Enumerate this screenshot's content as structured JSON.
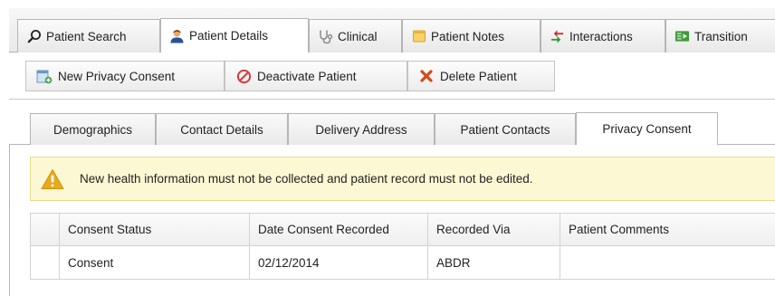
{
  "top_tabs": [
    {
      "label": "Patient Search",
      "icon": "search-icon",
      "active": false
    },
    {
      "label": "Patient Details",
      "icon": "person-icon",
      "active": true
    },
    {
      "label": "Clinical",
      "icon": "stethoscope-icon",
      "active": false
    },
    {
      "label": "Patient Notes",
      "icon": "note-icon",
      "active": false
    },
    {
      "label": "Interactions",
      "icon": "swap-arrows-icon",
      "active": false
    },
    {
      "label": "Transition",
      "icon": "transition-icon",
      "active": false
    }
  ],
  "toolbar": {
    "new_consent": "New Privacy Consent",
    "deactivate": "Deactivate Patient",
    "delete": "Delete Patient"
  },
  "sub_tabs": [
    {
      "label": "Demographics",
      "active": false
    },
    {
      "label": "Contact Details",
      "active": false
    },
    {
      "label": "Delivery Address",
      "active": false
    },
    {
      "label": "Patient Contacts",
      "active": false
    },
    {
      "label": "Privacy Consent",
      "active": true
    }
  ],
  "warning": {
    "message": "New health information must not be collected and patient record must not be edited.",
    "icon": "warning-icon"
  },
  "grid": {
    "columns": [
      "Consent Status",
      "Date Consent Recorded",
      "Recorded Via",
      "Patient Comments"
    ],
    "rows": [
      [
        "Consent",
        "02/12/2014",
        "ABDR",
        ""
      ]
    ]
  },
  "colors": {
    "warning_bg": "#fcf8d4",
    "warning_icon": "#e8a91c",
    "delete_red": "#d24a1a",
    "deactivate_red": "#d83a3a"
  }
}
